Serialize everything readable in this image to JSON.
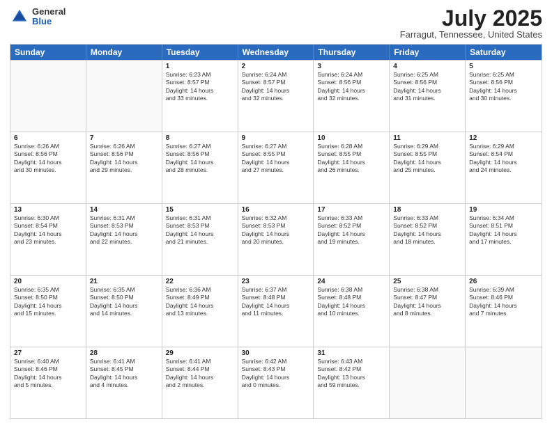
{
  "header": {
    "logo_general": "General",
    "logo_blue": "Blue",
    "month_title": "July 2025",
    "location": "Farragut, Tennessee, United States"
  },
  "calendar": {
    "days_of_week": [
      "Sunday",
      "Monday",
      "Tuesday",
      "Wednesday",
      "Thursday",
      "Friday",
      "Saturday"
    ],
    "rows": [
      [
        {
          "day": "",
          "empty": true,
          "lines": []
        },
        {
          "day": "",
          "empty": true,
          "lines": []
        },
        {
          "day": "1",
          "lines": [
            "Sunrise: 6:23 AM",
            "Sunset: 8:57 PM",
            "Daylight: 14 hours",
            "and 33 minutes."
          ]
        },
        {
          "day": "2",
          "lines": [
            "Sunrise: 6:24 AM",
            "Sunset: 8:57 PM",
            "Daylight: 14 hours",
            "and 32 minutes."
          ]
        },
        {
          "day": "3",
          "lines": [
            "Sunrise: 6:24 AM",
            "Sunset: 8:56 PM",
            "Daylight: 14 hours",
            "and 32 minutes."
          ]
        },
        {
          "day": "4",
          "lines": [
            "Sunrise: 6:25 AM",
            "Sunset: 8:56 PM",
            "Daylight: 14 hours",
            "and 31 minutes."
          ]
        },
        {
          "day": "5",
          "lines": [
            "Sunrise: 6:25 AM",
            "Sunset: 8:56 PM",
            "Daylight: 14 hours",
            "and 30 minutes."
          ]
        }
      ],
      [
        {
          "day": "6",
          "lines": [
            "Sunrise: 6:26 AM",
            "Sunset: 8:56 PM",
            "Daylight: 14 hours",
            "and 30 minutes."
          ]
        },
        {
          "day": "7",
          "lines": [
            "Sunrise: 6:26 AM",
            "Sunset: 8:56 PM",
            "Daylight: 14 hours",
            "and 29 minutes."
          ]
        },
        {
          "day": "8",
          "lines": [
            "Sunrise: 6:27 AM",
            "Sunset: 8:56 PM",
            "Daylight: 14 hours",
            "and 28 minutes."
          ]
        },
        {
          "day": "9",
          "lines": [
            "Sunrise: 6:27 AM",
            "Sunset: 8:55 PM",
            "Daylight: 14 hours",
            "and 27 minutes."
          ]
        },
        {
          "day": "10",
          "lines": [
            "Sunrise: 6:28 AM",
            "Sunset: 8:55 PM",
            "Daylight: 14 hours",
            "and 26 minutes."
          ]
        },
        {
          "day": "11",
          "lines": [
            "Sunrise: 6:29 AM",
            "Sunset: 8:55 PM",
            "Daylight: 14 hours",
            "and 25 minutes."
          ]
        },
        {
          "day": "12",
          "lines": [
            "Sunrise: 6:29 AM",
            "Sunset: 8:54 PM",
            "Daylight: 14 hours",
            "and 24 minutes."
          ]
        }
      ],
      [
        {
          "day": "13",
          "lines": [
            "Sunrise: 6:30 AM",
            "Sunset: 8:54 PM",
            "Daylight: 14 hours",
            "and 23 minutes."
          ]
        },
        {
          "day": "14",
          "lines": [
            "Sunrise: 6:31 AM",
            "Sunset: 8:53 PM",
            "Daylight: 14 hours",
            "and 22 minutes."
          ]
        },
        {
          "day": "15",
          "lines": [
            "Sunrise: 6:31 AM",
            "Sunset: 8:53 PM",
            "Daylight: 14 hours",
            "and 21 minutes."
          ]
        },
        {
          "day": "16",
          "lines": [
            "Sunrise: 6:32 AM",
            "Sunset: 8:53 PM",
            "Daylight: 14 hours",
            "and 20 minutes."
          ]
        },
        {
          "day": "17",
          "lines": [
            "Sunrise: 6:33 AM",
            "Sunset: 8:52 PM",
            "Daylight: 14 hours",
            "and 19 minutes."
          ]
        },
        {
          "day": "18",
          "lines": [
            "Sunrise: 6:33 AM",
            "Sunset: 8:52 PM",
            "Daylight: 14 hours",
            "and 18 minutes."
          ]
        },
        {
          "day": "19",
          "lines": [
            "Sunrise: 6:34 AM",
            "Sunset: 8:51 PM",
            "Daylight: 14 hours",
            "and 17 minutes."
          ]
        }
      ],
      [
        {
          "day": "20",
          "lines": [
            "Sunrise: 6:35 AM",
            "Sunset: 8:50 PM",
            "Daylight: 14 hours",
            "and 15 minutes."
          ]
        },
        {
          "day": "21",
          "lines": [
            "Sunrise: 6:35 AM",
            "Sunset: 8:50 PM",
            "Daylight: 14 hours",
            "and 14 minutes."
          ]
        },
        {
          "day": "22",
          "lines": [
            "Sunrise: 6:36 AM",
            "Sunset: 8:49 PM",
            "Daylight: 14 hours",
            "and 13 minutes."
          ]
        },
        {
          "day": "23",
          "lines": [
            "Sunrise: 6:37 AM",
            "Sunset: 8:48 PM",
            "Daylight: 14 hours",
            "and 11 minutes."
          ]
        },
        {
          "day": "24",
          "lines": [
            "Sunrise: 6:38 AM",
            "Sunset: 8:48 PM",
            "Daylight: 14 hours",
            "and 10 minutes."
          ]
        },
        {
          "day": "25",
          "lines": [
            "Sunrise: 6:38 AM",
            "Sunset: 8:47 PM",
            "Daylight: 14 hours",
            "and 8 minutes."
          ]
        },
        {
          "day": "26",
          "lines": [
            "Sunrise: 6:39 AM",
            "Sunset: 8:46 PM",
            "Daylight: 14 hours",
            "and 7 minutes."
          ]
        }
      ],
      [
        {
          "day": "27",
          "lines": [
            "Sunrise: 6:40 AM",
            "Sunset: 8:46 PM",
            "Daylight: 14 hours",
            "and 5 minutes."
          ]
        },
        {
          "day": "28",
          "lines": [
            "Sunrise: 6:41 AM",
            "Sunset: 8:45 PM",
            "Daylight: 14 hours",
            "and 4 minutes."
          ]
        },
        {
          "day": "29",
          "lines": [
            "Sunrise: 6:41 AM",
            "Sunset: 8:44 PM",
            "Daylight: 14 hours",
            "and 2 minutes."
          ]
        },
        {
          "day": "30",
          "lines": [
            "Sunrise: 6:42 AM",
            "Sunset: 8:43 PM",
            "Daylight: 14 hours",
            "and 0 minutes."
          ]
        },
        {
          "day": "31",
          "lines": [
            "Sunrise: 6:43 AM",
            "Sunset: 8:42 PM",
            "Daylight: 13 hours",
            "and 59 minutes."
          ]
        },
        {
          "day": "",
          "empty": true,
          "lines": []
        },
        {
          "day": "",
          "empty": true,
          "lines": []
        }
      ]
    ]
  }
}
